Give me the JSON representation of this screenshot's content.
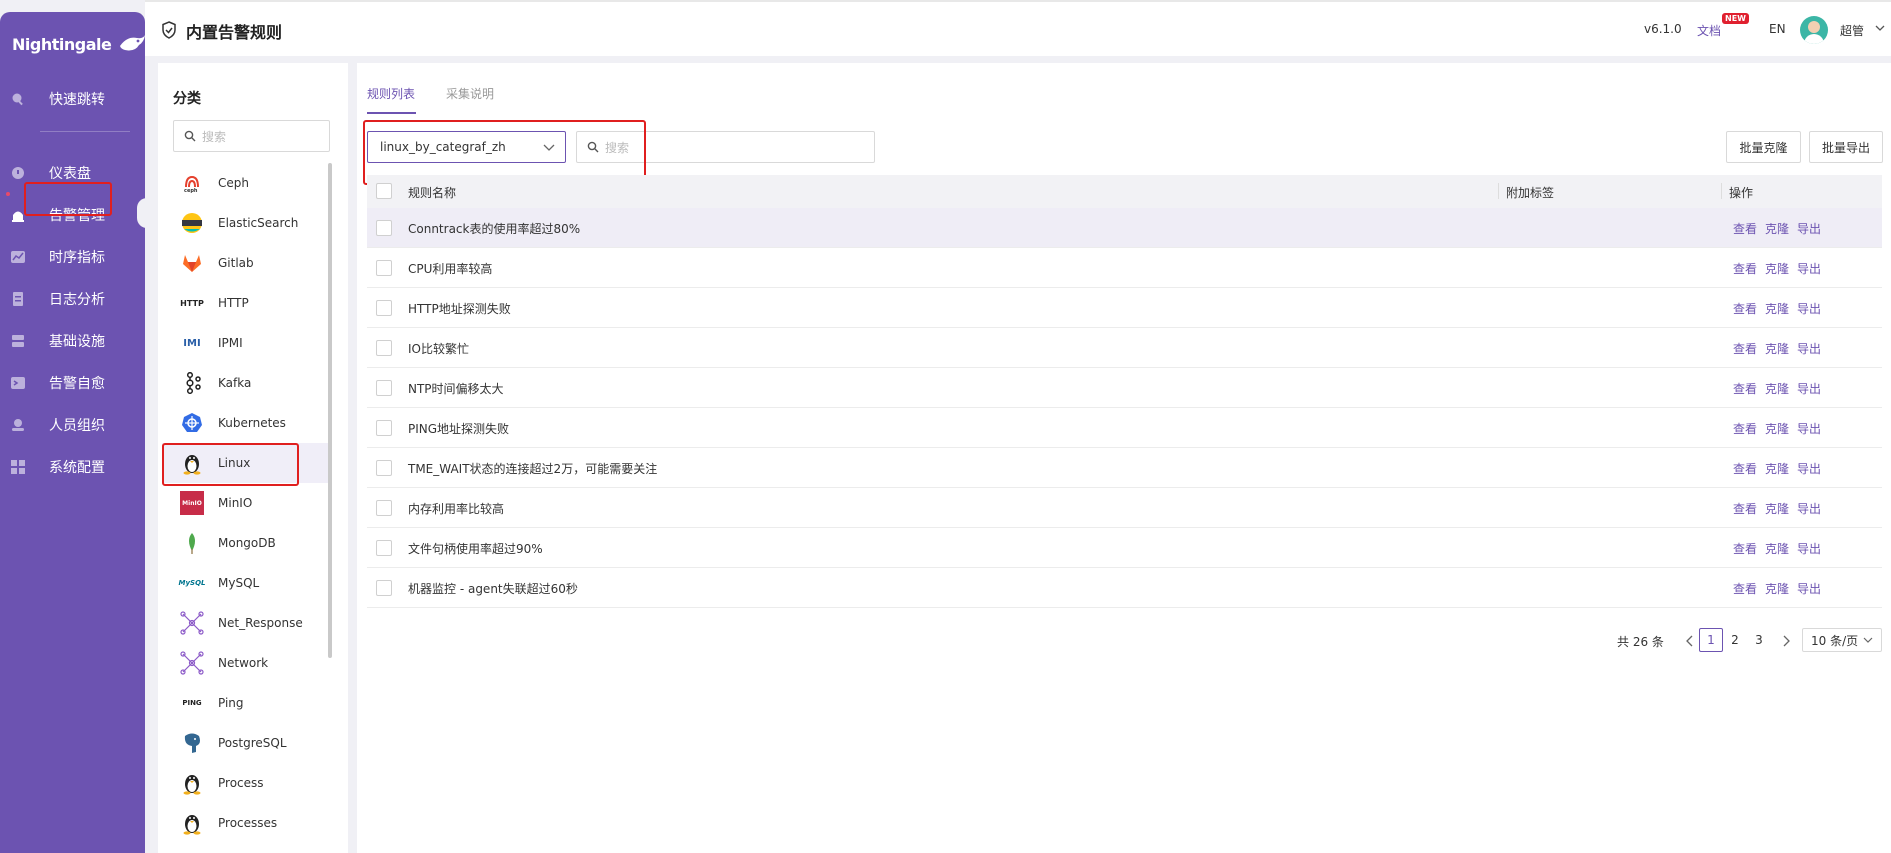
{
  "app": {
    "logo_text": "Nightingale"
  },
  "sidebar": {
    "items": [
      {
        "label": "快速跳转",
        "icon": "search-icon"
      },
      {
        "label": "仪表盘",
        "icon": "dashboard-icon"
      },
      {
        "label": "告警管理",
        "icon": "alarm-icon"
      },
      {
        "label": "时序指标",
        "icon": "chart-icon"
      },
      {
        "label": "日志分析",
        "icon": "log-icon"
      },
      {
        "label": "基础设施",
        "icon": "server-icon"
      },
      {
        "label": "告警自愈",
        "icon": "terminal-icon"
      },
      {
        "label": "人员组织",
        "icon": "user-icon"
      },
      {
        "label": "系统配置",
        "icon": "settings-grid-icon"
      }
    ]
  },
  "header": {
    "title": "内置告警规则",
    "version": "v6.1.0",
    "docs": "文档",
    "new_badge": "NEW",
    "lang": "EN",
    "user": "超管"
  },
  "categories": {
    "title": "分类",
    "search_placeholder": "搜索",
    "items": [
      {
        "label": "Ceph",
        "icon": "ceph-icon"
      },
      {
        "label": "ElasticSearch",
        "icon": "elasticsearch-icon"
      },
      {
        "label": "Gitlab",
        "icon": "gitlab-icon"
      },
      {
        "label": "HTTP",
        "icon": "http-icon"
      },
      {
        "label": "IPMI",
        "icon": "ipmi-icon"
      },
      {
        "label": "Kafka",
        "icon": "kafka-icon"
      },
      {
        "label": "Kubernetes",
        "icon": "kubernetes-icon"
      },
      {
        "label": "Linux",
        "icon": "linux-penguin-icon"
      },
      {
        "label": "MinIO",
        "icon": "minio-icon"
      },
      {
        "label": "MongoDB",
        "icon": "mongodb-icon"
      },
      {
        "label": "MySQL",
        "icon": "mysql-icon"
      },
      {
        "label": "Net_Response",
        "icon": "network-nodes-icon"
      },
      {
        "label": "Network",
        "icon": "network-nodes-icon"
      },
      {
        "label": "Ping",
        "icon": "ping-icon"
      },
      {
        "label": "PostgreSQL",
        "icon": "postgresql-icon"
      },
      {
        "label": "Process",
        "icon": "linux-penguin-icon"
      },
      {
        "label": "Processes",
        "icon": "linux-penguin-icon"
      }
    ]
  },
  "main": {
    "tabs": [
      {
        "label": "规则列表"
      },
      {
        "label": "采集说明"
      }
    ],
    "select_value": "linux_by_categraf_zh",
    "search_placeholder": "搜索",
    "buttons": {
      "clone": "批量克隆",
      "export": "批量导出"
    },
    "table": {
      "headers": {
        "name": "规则名称",
        "tags": "附加标签",
        "actions": "操作"
      },
      "actions": {
        "view": "查看",
        "clone": "克隆",
        "export": "导出"
      },
      "rows": [
        "Conntrack表的使用率超过80%",
        "CPU利用率较高",
        "HTTP地址探测失败",
        "IO比较繁忙",
        "NTP时间偏移太大",
        "PING地址探测失败",
        "TME_WAIT状态的连接超过2万，可能需要关注",
        "内存利用率比较高",
        "文件句柄使用率超过90%",
        "机器监控 - agent失联超过60秒"
      ]
    },
    "pagination": {
      "total": "共 26 条",
      "pages": [
        "1",
        "2",
        "3"
      ],
      "current": "1",
      "page_size": "10 条/页"
    }
  },
  "colors": {
    "brand": "#6c53b1",
    "highlight": "#e01f1f"
  }
}
